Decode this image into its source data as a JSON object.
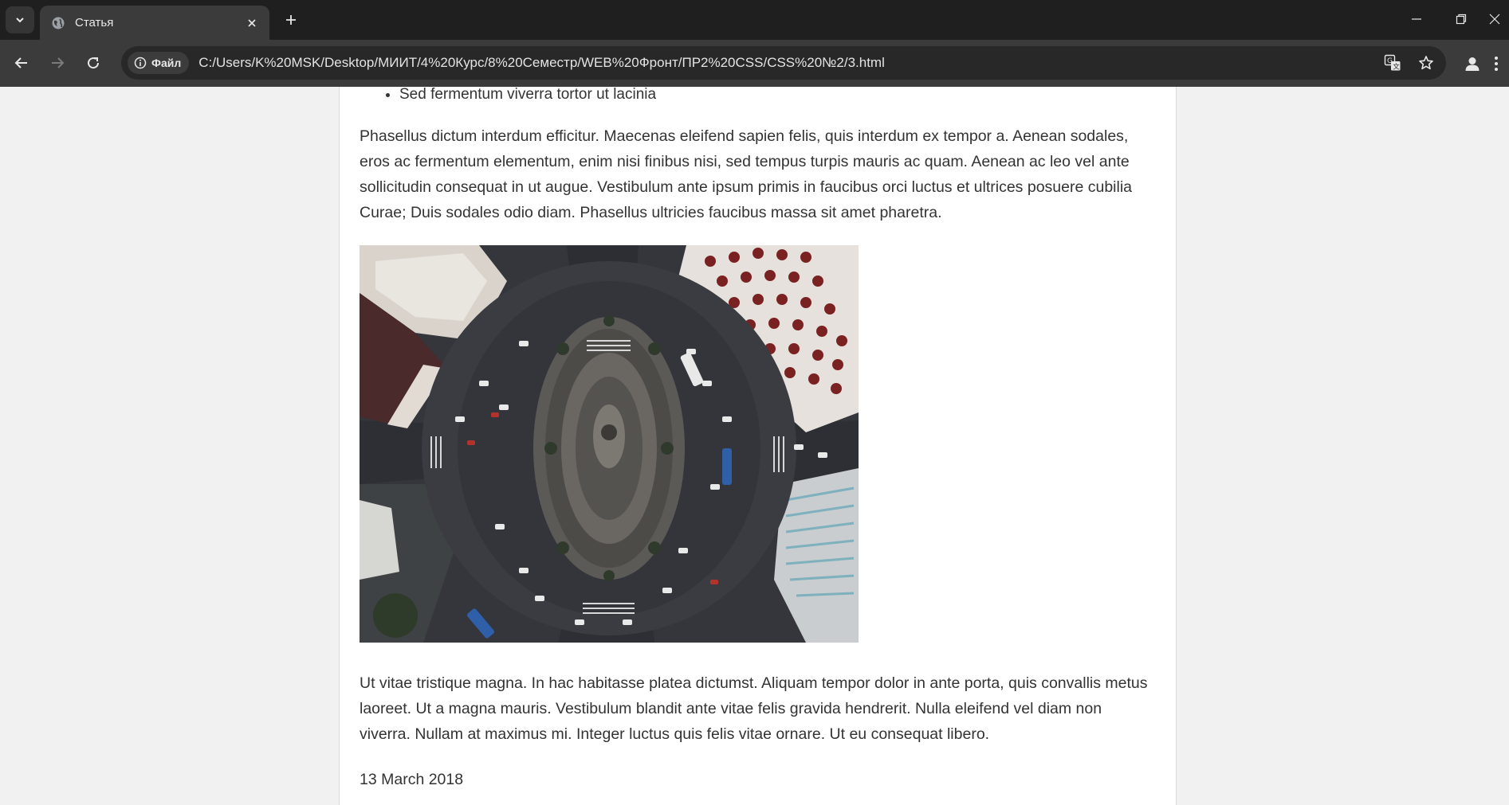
{
  "browser": {
    "tab": {
      "title": "Статья",
      "favicon": "globe-icon"
    },
    "address_bar": {
      "security_chip": "Файл",
      "url": "C:/Users/K%20MSK/Desktop/МИИТ/4%20Курс/8%20Семестр/WEB%20Фронт/ПР2%20CSS/CSS%20№2/3.html"
    },
    "icons": {
      "tab_list": "chevron-down-icon",
      "new_tab": "plus-icon",
      "back": "arrow-left-icon",
      "forward": "arrow-right-icon",
      "reload": "reload-icon",
      "translate": "translate-icon",
      "bookmark": "star-icon",
      "profile": "person-icon",
      "menu": "kebab-icon",
      "minimize": "minimize-icon",
      "restore": "restore-icon",
      "close": "close-icon"
    }
  },
  "article": {
    "list_items": [
      "Sed fermentum viverra tortor ut lacinia"
    ],
    "paragraph_1": "Phasellus dictum interdum efficitur. Maecenas eleifend sapien felis, quis interdum ex tempor a. Aenean sodales, eros ac fermentum elementum, enim nisi finibus nisi, sed tempus turpis mauris ac quam. Aenean ac leo vel ante sollicitudin consequat in ut augue. Vestibulum ante ipsum primis in faucibus orci luctus et ultrices posuere cubilia Curae; Duis sodales odio diam. Phasellus ultricies faucibus massa sit amet pharetra.",
    "paragraph_2": "Ut vitae tristique magna. In hac habitasse platea dictumst. Aliquam tempor dolor in ante porta, quis convallis metus laoreet. Ut a magna mauris. Vestibulum blandit ante vitae felis gravida hendrerit. Nulla eleifend vel diam non viverra. Nullam at maximus mi. Integer luctus quis felis vitae ornare. Ut eu consequat libero.",
    "date": "13 March 2018"
  },
  "colors": {
    "tabbar": "#1f1f1f",
    "toolbar": "#3b3b3b",
    "omnibox": "#282828",
    "page_bg": "#f1f1f1",
    "text": "#333333"
  }
}
